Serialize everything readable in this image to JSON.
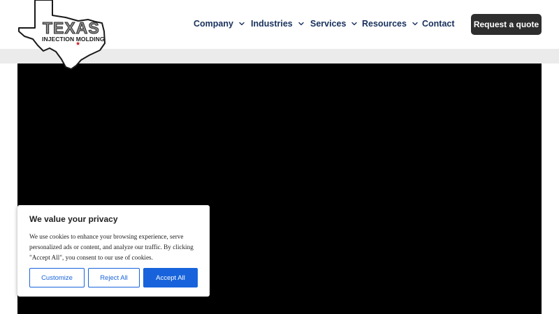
{
  "logo": {
    "line1": "TEXAS",
    "line2": "INJECTION MOLDING",
    "star": "★"
  },
  "nav": {
    "items": [
      {
        "label": "Company",
        "has_dropdown": true
      },
      {
        "label": "Industries",
        "has_dropdown": true
      },
      {
        "label": "Services",
        "has_dropdown": true
      },
      {
        "label": "Resources",
        "has_dropdown": true
      },
      {
        "label": "Contact",
        "has_dropdown": false
      }
    ],
    "cta_label": "Request a quote"
  },
  "cookie_banner": {
    "title": "We value your privacy",
    "text": "We use cookies to enhance your browsing experience, serve personalized ads or content, and analyze our traffic. By clicking \"Accept All\", you consent to our use of cookies.",
    "customize_label": "Customize",
    "reject_label": "Reject All",
    "accept_label": "Accept All"
  },
  "colors": {
    "nav_text": "#17305c",
    "cta_bg": "#2e2e2e",
    "cookie_accent": "#1863dc",
    "hero_bg": "#000000",
    "band_bg": "#ebebeb",
    "logo_star": "#c4161c"
  },
  "icons": {
    "dropdown": "chevron-down-icon",
    "logo_shape": "texas-outline-icon"
  }
}
